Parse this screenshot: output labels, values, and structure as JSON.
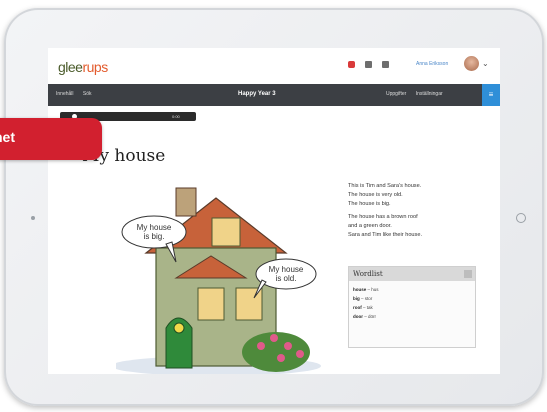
{
  "logo": {
    "text_g": "glee",
    "text_r": "rups"
  },
  "header": {
    "user_name": "Anna Eriksson"
  },
  "navbar": {
    "left_items": [
      "Innehåll",
      "Sök"
    ],
    "title": "Happy Year 3",
    "right_items": [
      "Uppgifter",
      "Inställningar"
    ]
  },
  "audio": {
    "time": "0:00"
  },
  "banner": {
    "text": "het"
  },
  "page": {
    "title": "My house"
  },
  "story": {
    "lines_1": [
      "This is Tim and Sara’s house.",
      "The house is very old.",
      "The house is big."
    ],
    "lines_2": [
      "The house has a brown roof",
      "and a green door.",
      "Sara and Tim like their house."
    ]
  },
  "wordlist": {
    "title": "Wordlist",
    "items": [
      {
        "word": "house",
        "translation": "hus"
      },
      {
        "word": "big",
        "translation": "stor"
      },
      {
        "word": "roof",
        "translation": "tak"
      },
      {
        "word": "door",
        "translation": "dörr"
      }
    ]
  },
  "illustration": {
    "bubble_1": [
      "My house",
      "is big."
    ],
    "bubble_2": [
      "My house",
      "is old."
    ]
  },
  "colors": {
    "accent": "#d2202f",
    "nav": "#3c3f44",
    "nav_button": "#2f8fd8"
  }
}
